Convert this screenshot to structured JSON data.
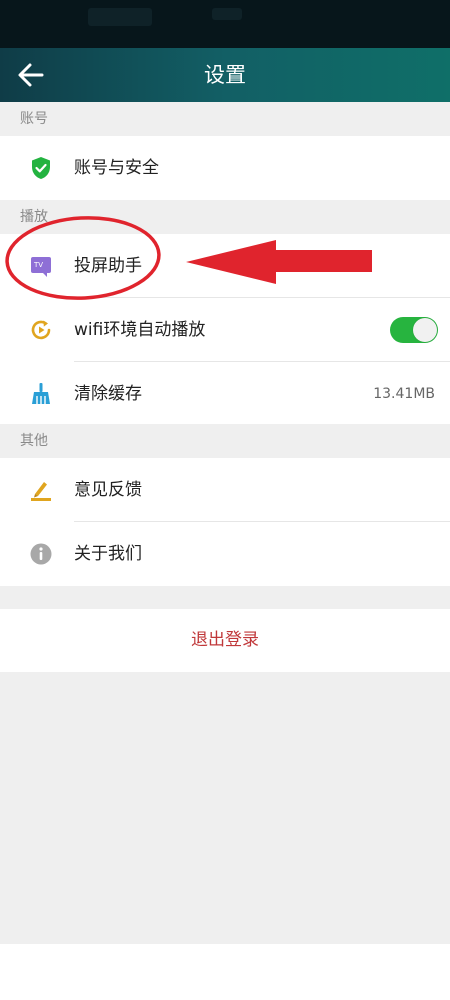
{
  "app_bar": {
    "title": "设置"
  },
  "sections": {
    "account": {
      "header": "账号",
      "items": [
        {
          "label": "账号与安全",
          "icon": "shield-check-icon"
        }
      ]
    },
    "playback": {
      "header": "播放",
      "items": [
        {
          "label": "投屏助手",
          "icon": "tv-screen-cast-icon"
        },
        {
          "label": "wifi环境自动播放",
          "icon": "autoplay-icon",
          "toggle_on": true
        },
        {
          "label": "清除缓存",
          "icon": "broom-icon",
          "value": "13.41MB"
        }
      ]
    },
    "other": {
      "header": "其他",
      "items": [
        {
          "label": "意见反馈",
          "icon": "feedback-pen-icon"
        },
        {
          "label": "关于我们",
          "icon": "info-icon"
        }
      ]
    }
  },
  "logout": {
    "label": "退出登录"
  },
  "colors": {
    "app_bar_gradient": [
      "#0f3c47",
      "#0f6f68"
    ],
    "toggle_on": "#27b43f",
    "logout_text": "#c0383a",
    "annotation_red": "#e0242d"
  }
}
